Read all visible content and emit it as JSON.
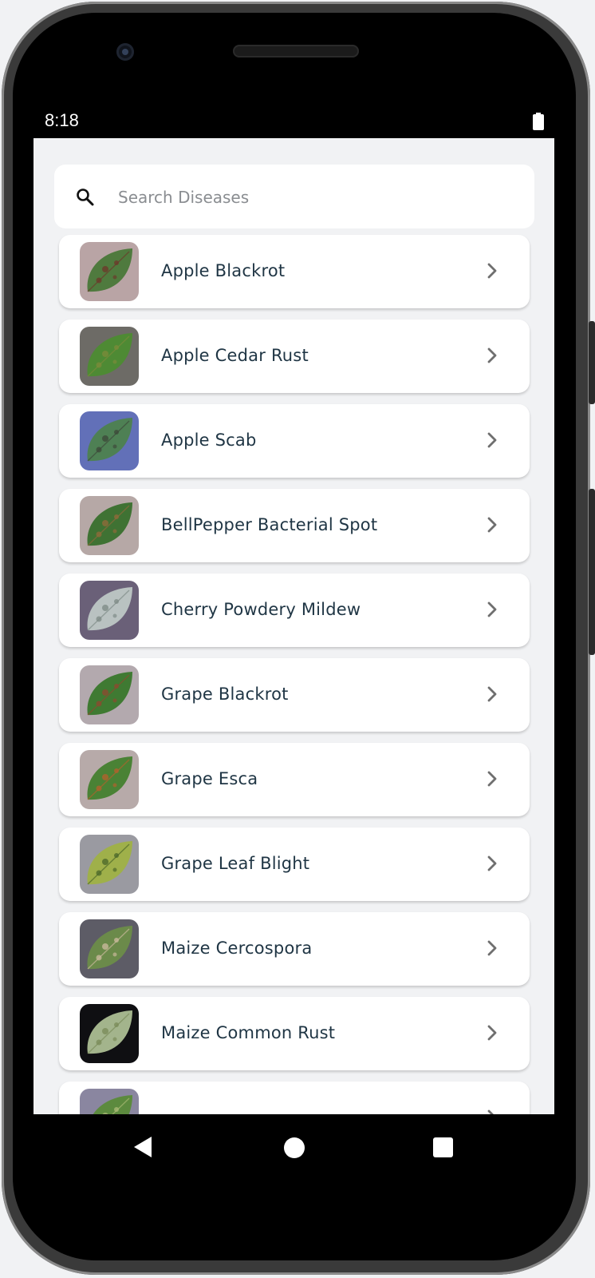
{
  "status_bar": {
    "time": "8:18",
    "battery_icon": "battery-full-icon"
  },
  "search": {
    "placeholder": "Search Diseases",
    "value": "",
    "icon": "search-icon"
  },
  "diseases": [
    {
      "label": "Apple Blackrot",
      "thumb_colors": [
        "#b9a4a5",
        "#4f7a3e",
        "#6b3b2b"
      ]
    },
    {
      "label": "Apple Cedar Rust",
      "thumb_colors": [
        "#6d6b66",
        "#4e8a34",
        "#7a8a3a"
      ]
    },
    {
      "label": "Apple Scab",
      "thumb_colors": [
        "#6270b8",
        "#4e8054",
        "#3d4a3a"
      ]
    },
    {
      "label": "BellPepper Bacterial Spot",
      "thumb_colors": [
        "#b6a8a6",
        "#3f7233",
        "#8f6a3a"
      ]
    },
    {
      "label": "Cherry Powdery Mildew",
      "thumb_colors": [
        "#6a6078",
        "#b9c2c1",
        "#7f8c87"
      ]
    },
    {
      "label": "Grape Blackrot",
      "thumb_colors": [
        "#b3a9ae",
        "#3f7a32",
        "#8b4b2f"
      ]
    },
    {
      "label": "Grape Esca",
      "thumb_colors": [
        "#b7aaa9",
        "#4a8235",
        "#b0612d"
      ]
    },
    {
      "label": "Grape Leaf Blight",
      "thumb_colors": [
        "#9a9aa1",
        "#9fb04a",
        "#4e6a2a"
      ]
    },
    {
      "label": "Maize Cercospora",
      "thumb_colors": [
        "#5d5c66",
        "#6b8a4a",
        "#c8b89a"
      ]
    },
    {
      "label": "Maize Common Rust",
      "thumb_colors": [
        "#0f0f12",
        "#a3b48c",
        "#7b8c5a"
      ]
    },
    {
      "label": "",
      "thumb_colors": [
        "#8a86a0",
        "#5c8a3e",
        "#a8b874"
      ]
    }
  ],
  "nav_bar": {
    "back": "back-triangle-icon",
    "home": "home-circle-icon",
    "recents": "recents-square-icon"
  }
}
